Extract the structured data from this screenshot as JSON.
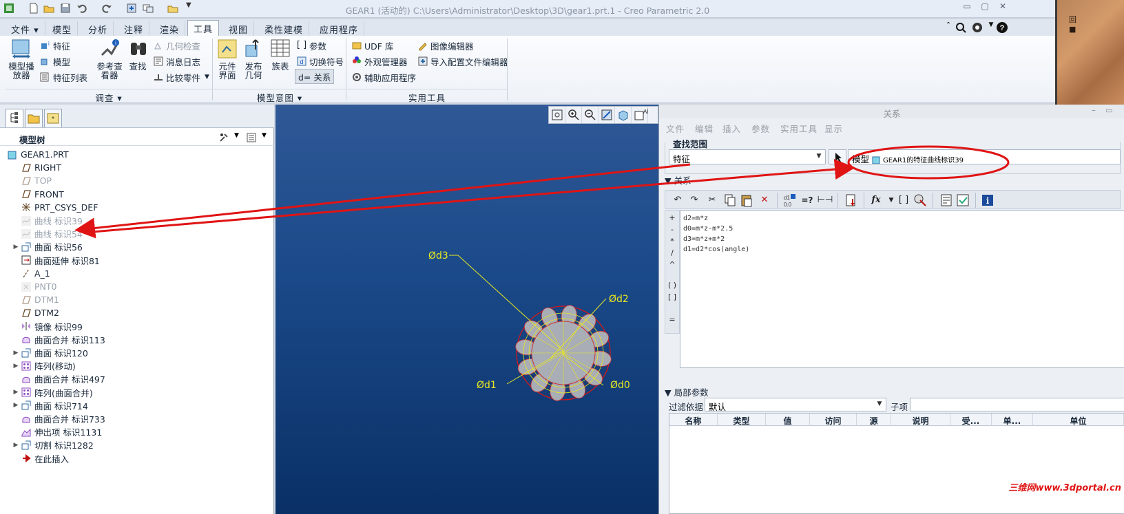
{
  "window": {
    "title": "GEAR1 (活动的) C:\\Users\\Administrator\\Desktop\\3D\\gear1.prt.1 - Creo Parametric 2.0"
  },
  "tabs": [
    {
      "label": "文件",
      "has_arrow": true
    },
    {
      "label": "模型"
    },
    {
      "label": "分析"
    },
    {
      "label": "注释"
    },
    {
      "label": "渲染"
    },
    {
      "label": "工具",
      "active": true
    },
    {
      "label": "视图"
    },
    {
      "label": "柔性建模"
    },
    {
      "label": "应用程序"
    }
  ],
  "ribbon": {
    "investigate": {
      "model_player": "模型播\n放器",
      "feature": "特征",
      "model": "模型",
      "feature_list": "特征列表",
      "reference_viewer": "参考查\n看器",
      "find": "查找",
      "geometry_check": "几何检查",
      "message_log": "消息日志",
      "compare_part": "比较零件",
      "group_label": "调查"
    },
    "model_intent": {
      "component_interface": "元件\n界面",
      "publish_geometry": "发布\n几何",
      "family_table": "族表",
      "parameters": "参数",
      "switch_symbols": "切换符号",
      "relations": "d= 关系",
      "group_label": "模型意图"
    },
    "utilities": {
      "udf_library": "UDF 库",
      "appearance_manager": "外观管理器",
      "aux_applications": "辅助应用程序",
      "image_editor": "图像编辑器",
      "import_config_editor": "导入配置文件编辑器",
      "group_label": "实用工具"
    }
  },
  "model_tree": {
    "title": "模型树",
    "items": [
      {
        "label": "GEAR1.PRT",
        "icon": "part-icon",
        "level": 0
      },
      {
        "label": "RIGHT",
        "icon": "datum-plane-icon",
        "level": 1
      },
      {
        "label": "TOP",
        "icon": "datum-plane-icon",
        "level": 1,
        "dim": true
      },
      {
        "label": "FRONT",
        "icon": "datum-plane-icon",
        "level": 1
      },
      {
        "label": "PRT_CSYS_DEF",
        "icon": "csys-icon",
        "level": 1
      },
      {
        "label": "曲线 标识39",
        "icon": "curve-icon",
        "level": 1,
        "dim": true
      },
      {
        "label": "曲线 标识54",
        "icon": "curve-icon",
        "level": 1,
        "dim": true
      },
      {
        "label": "曲面 标识56",
        "icon": "surface-icon",
        "level": 1,
        "expandable": true
      },
      {
        "label": "曲面延伸 标识81",
        "icon": "extend-icon",
        "level": 1
      },
      {
        "label": "A_1",
        "icon": "axis-icon",
        "level": 1
      },
      {
        "label": "PNT0",
        "icon": "point-icon",
        "level": 1,
        "dim": true
      },
      {
        "label": "DTM1",
        "icon": "datum-plane-icon",
        "level": 1,
        "dim": true
      },
      {
        "label": "DTM2",
        "icon": "datum-plane-icon",
        "level": 1
      },
      {
        "label": "镜像 标识99",
        "icon": "mirror-icon",
        "level": 1
      },
      {
        "label": "曲面合并 标识113",
        "icon": "merge-icon",
        "level": 1
      },
      {
        "label": "曲面 标识120",
        "icon": "surface-icon",
        "level": 1,
        "expandable": true
      },
      {
        "label": "阵列(移动)",
        "icon": "pattern-icon",
        "level": 1,
        "expandable": true
      },
      {
        "label": "曲面合并 标识497",
        "icon": "merge-icon",
        "level": 1
      },
      {
        "label": "阵列(曲面合并)",
        "icon": "pattern-icon",
        "level": 1,
        "expandable": true
      },
      {
        "label": "曲面 标识714",
        "icon": "surface-icon",
        "level": 1,
        "expandable": true
      },
      {
        "label": "曲面合并 标识733",
        "icon": "merge-icon",
        "level": 1
      },
      {
        "label": "伸出项 标识1131",
        "icon": "protrusion-icon",
        "level": 1
      },
      {
        "label": "切割 标识1282",
        "icon": "cut-icon",
        "level": 1,
        "expandable": true
      },
      {
        "label": "在此插入",
        "icon": "insert-here-icon",
        "level": 1
      }
    ]
  },
  "viewport": {
    "dim_labels": {
      "d3": "Ød3",
      "d2": "Ød2",
      "d1": "Ød1",
      "d0": "Ød0"
    }
  },
  "relations_dialog": {
    "title": "关系",
    "menu": [
      "文件",
      "编辑",
      "插入",
      "参数",
      "实用工具",
      "显示"
    ],
    "search_scope_label": "查找范围",
    "scope_value": "特征",
    "scope_path_prefix": "模型",
    "scope_path": "GEAR1的特征曲线标识39",
    "relations_label": "关系",
    "code_lines": [
      "d2=m*z",
      "d0=m*z-m*2.5",
      "d3=m*z+m*2",
      "d1=d2*cos(angle)"
    ],
    "local_params_label": "局部参数",
    "filter_label": "过滤依据",
    "filter_value": "默认",
    "subitem_label": "子项",
    "columns": [
      "名称",
      "类型",
      "值",
      "访问",
      "源",
      "说明",
      "受...",
      "单...",
      "单位"
    ]
  },
  "watermark": "三维网www.3dportal.cn"
}
